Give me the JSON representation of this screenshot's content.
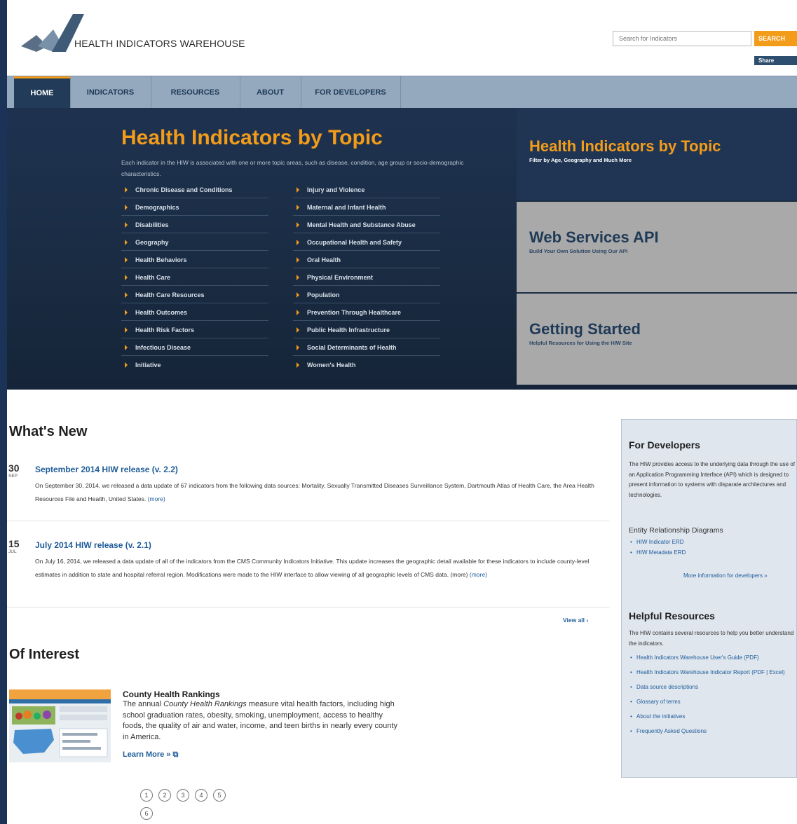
{
  "header": {
    "logo_text": "HEALTH INDICATORS WAREHOUSE",
    "search_placeholder": "Search for Indicators",
    "search_label": "SEARCH",
    "share_label": "Share"
  },
  "nav": {
    "items": [
      "HOME",
      "INDICATORS",
      "RESOURCES",
      "ABOUT",
      "FOR DEVELOPERS"
    ],
    "active": "HOME"
  },
  "hero": {
    "title": "Health Indicators by Topic",
    "description": "Each indicator in the HIW is associated with one or more topic areas, such as disease, condition, age group or socio-demographic characteristics.",
    "topics_left": [
      "Chronic Disease and Conditions",
      "Demographics",
      "Disabilities",
      "Geography",
      "Health Behaviors",
      "Health Care",
      "Health Care Resources",
      "Health Outcomes",
      "Health Risk Factors",
      "Infectious Disease",
      "Initiative"
    ],
    "topics_right": [
      "Injury and Violence",
      "Maternal and Infant Health",
      "Mental Health and Substance Abuse",
      "Occupational Health and Safety",
      "Oral Health",
      "Physical Environment",
      "Population",
      "Prevention Through Healthcare",
      "Public Health Infrastructure",
      "Social Determinants of Health",
      "Women's Health"
    ],
    "panels": [
      {
        "title": "Health Indicators by Topic",
        "subtitle": "Filter by Age, Geography and Much More"
      },
      {
        "title": "Web Services API",
        "subtitle": "Build Your Own Solution Using Our API"
      },
      {
        "title": "Getting Started",
        "subtitle": "Helpful Resources for Using the HIW Site"
      }
    ]
  },
  "whats_new": {
    "heading": "What's New",
    "items": [
      {
        "day": "30",
        "month": "SEP",
        "title": "September 2014 HIW release (v. 2.2)",
        "body": "On September 30, 2014, we released a data update of 67 indicators from the following data sources: Mortality, Sexually Transmitted Diseases Surveillance System, Dartmouth Atlas of Health Care, the Area Health Resources File and Health, United States.",
        "more": "(more)"
      },
      {
        "day": "15",
        "month": "JUL",
        "title": "July 2014 HIW release (v. 2.1)",
        "body": "On July 16, 2014, we released a data update of all of the indicators from the CMS Community Indicators Initiative. This update increases the geographic detail available for these indicators to include county-level estimates in addition to state and hospital referral region. Modifications were made to the HIW interface to allow viewing of all geographic levels of CMS data. (more)",
        "more": "(more)"
      }
    ],
    "view_all": "View all ›"
  },
  "of_interest": {
    "heading": "Of Interest",
    "title": "County Health Rankings",
    "body_pre": "The annual ",
    "body_em": "County Health Rankings",
    "body_post": " measure vital health factors, including high school graduation rates, obesity, smoking, unemployment, access to healthy foods, the quality of air and water, income, and teen births in nearly every county in America.",
    "learn_more": "Learn More » ⧉",
    "pages": [
      "1",
      "2",
      "3",
      "4",
      "5",
      "6"
    ]
  },
  "sidebar": {
    "dev_heading": "For Developers",
    "dev_text": "The HIW provides access to the underlying data through the use of an Application Programming Interface (API) which is designed to present information to systems with disparate architectures and technologies.",
    "erd_heading": "Entity Relationship Diagrams",
    "erd_links": [
      "HIW Indicator ERD",
      "HIW Metadata ERD"
    ],
    "dev_more": "More information for developers »",
    "res_heading": "Helpful Resources",
    "res_text": "The HIW contains several resources to help you better understand the indicators.",
    "res_links": [
      "Health Indicators Warehouse User's Guide (PDF)",
      "Health Indicators Warehouse Indicator Report (PDF | Excel)",
      "Data source descriptions",
      "Glossary of terms",
      "About the initiatives",
      "Frequently Asked Questions"
    ]
  },
  "colors": {
    "accent": "#f39c1a",
    "nav_bg": "#94a9bd",
    "hero_bg": "#1c2e45",
    "link": "#1f5c99",
    "panel_grey": "#a9a9a9"
  }
}
